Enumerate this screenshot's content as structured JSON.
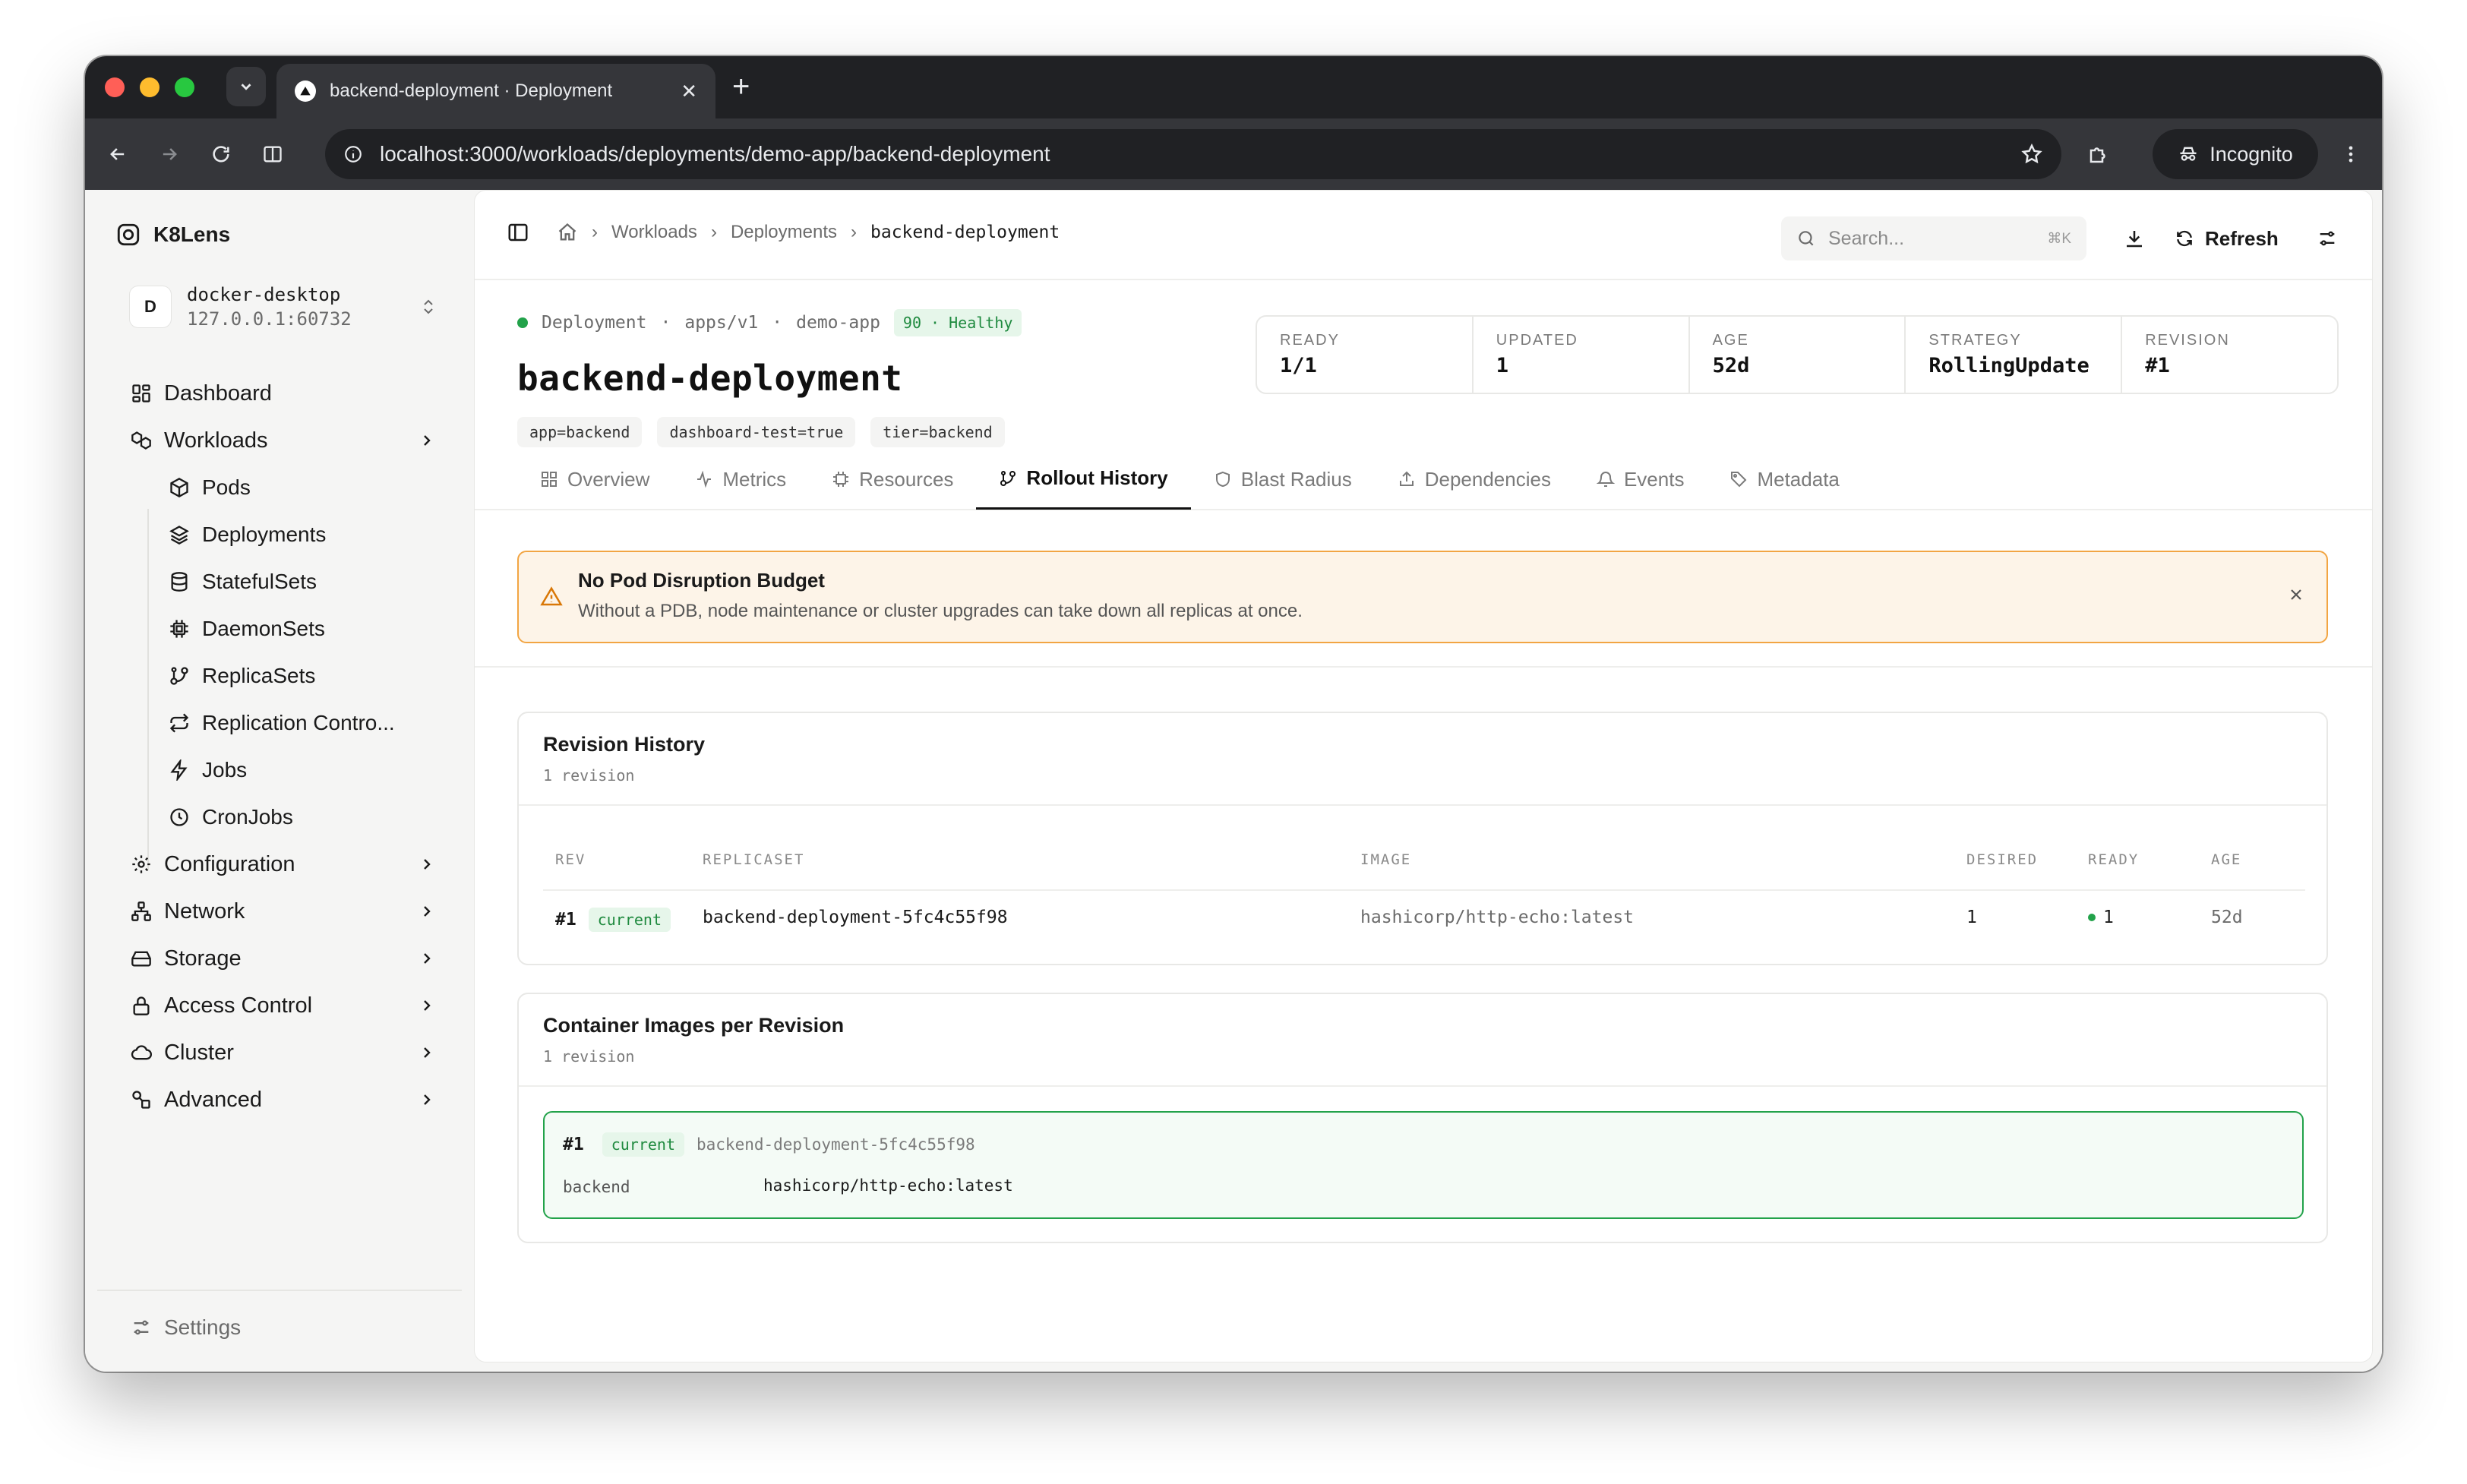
{
  "browser": {
    "tab_title": "backend-deployment · Deployment",
    "url": "localhost:3000/workloads/deployments/demo-app/backend-deployment",
    "incognito_label": "Incognito"
  },
  "sidebar": {
    "brand": "K8Lens",
    "cluster": {
      "avatar": "D",
      "name": "docker-desktop",
      "address": "127.0.0.1:60732"
    },
    "items": [
      {
        "label": "Dashboard",
        "icon": "grid-icon"
      },
      {
        "label": "Workloads",
        "icon": "boxes-icon",
        "expandable": true
      },
      {
        "label": "Configuration",
        "icon": "gear-icon",
        "expandable": true
      },
      {
        "label": "Network",
        "icon": "network-icon",
        "expandable": true
      },
      {
        "label": "Storage",
        "icon": "storage-icon",
        "expandable": true
      },
      {
        "label": "Access Control",
        "icon": "lock-icon",
        "expandable": true
      },
      {
        "label": "Cluster",
        "icon": "cloud-icon",
        "expandable": true
      },
      {
        "label": "Advanced",
        "icon": "advanced-icon",
        "expandable": true
      }
    ],
    "workloads_sub": [
      {
        "label": "Pods"
      },
      {
        "label": "Deployments"
      },
      {
        "label": "StatefulSets"
      },
      {
        "label": "DaemonSets"
      },
      {
        "label": "ReplicaSets"
      },
      {
        "label": "Replication Contro..."
      },
      {
        "label": "Jobs"
      },
      {
        "label": "CronJobs"
      }
    ],
    "settings_label": "Settings"
  },
  "topbar": {
    "breadcrumbs": [
      "Workloads",
      "Deployments",
      "backend-deployment"
    ],
    "search_placeholder": "Search...",
    "search_shortcut": "⌘K",
    "refresh_label": "Refresh"
  },
  "resource": {
    "kind": "Deployment",
    "api_version": "apps/v1",
    "namespace": "demo-app",
    "health_badge": "90 · Healthy",
    "name": "backend-deployment",
    "labels": [
      "app=backend",
      "dashboard-test=true",
      "tier=backend"
    ],
    "stats": [
      {
        "label": "READY",
        "value": "1/1"
      },
      {
        "label": "UPDATED",
        "value": "1"
      },
      {
        "label": "AGE",
        "value": "52d"
      },
      {
        "label": "STRATEGY",
        "value": "RollingUpdate"
      },
      {
        "label": "REVISION",
        "value": "#1"
      }
    ]
  },
  "tabs": [
    {
      "label": "Overview",
      "active": false
    },
    {
      "label": "Metrics",
      "active": false
    },
    {
      "label": "Resources",
      "active": false
    },
    {
      "label": "Rollout History",
      "active": true
    },
    {
      "label": "Blast Radius",
      "active": false
    },
    {
      "label": "Dependencies",
      "active": false
    },
    {
      "label": "Events",
      "active": false
    },
    {
      "label": "Metadata",
      "active": false
    }
  ],
  "alert": {
    "title": "No Pod Disruption Budget",
    "text": "Without a PDB, node maintenance or cluster upgrades can take down all replicas at once."
  },
  "revision_history": {
    "title": "Revision History",
    "subtitle": "1 revision",
    "columns": [
      "REV",
      "REPLICASET",
      "IMAGE",
      "DESIRED",
      "READY",
      "AGE"
    ],
    "rows": [
      {
        "rev": "#1",
        "badge": "current",
        "replicaset": "backend-deployment-5fc4c55f98",
        "image": "hashicorp/http-echo:latest",
        "desired": "1",
        "ready": "1",
        "age": "52d"
      }
    ]
  },
  "container_images": {
    "title": "Container Images per Revision",
    "subtitle": "1 revision",
    "revisions": [
      {
        "rev": "#1",
        "badge": "current",
        "replicaset": "backend-deployment-5fc4c55f98",
        "containers": [
          {
            "name": "backend",
            "image": "hashicorp/http-echo:latest"
          }
        ]
      }
    ]
  },
  "colors": {
    "accent_green": "#22a24a",
    "warning_orange": "#f2a543",
    "warning_bg": "#fdf4e8"
  }
}
